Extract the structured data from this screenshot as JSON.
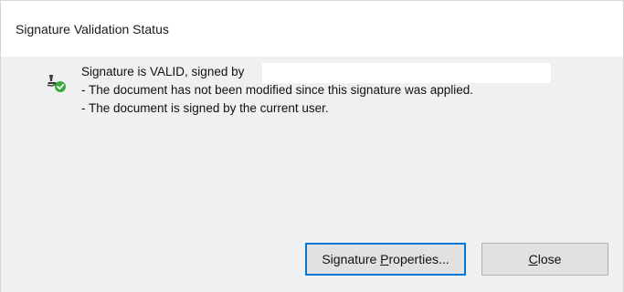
{
  "window": {
    "title": "Signature Validation Status"
  },
  "status": {
    "icon": "signature-valid-icon",
    "line1": "Signature is VALID, signed by",
    "line2": "- The document has not been modified since this signature was applied.",
    "line3": "- The document is signed by the current user."
  },
  "buttons": {
    "properties_prefix": "Signature ",
    "properties_mnemonic": "P",
    "properties_suffix": "roperties...",
    "close_mnemonic": "C",
    "close_suffix": "lose"
  },
  "colors": {
    "dialog_bg": "#f0f0f0",
    "title_bg": "#ffffff",
    "default_button_border": "#0078d7",
    "valid_check": "#3aa83a"
  }
}
